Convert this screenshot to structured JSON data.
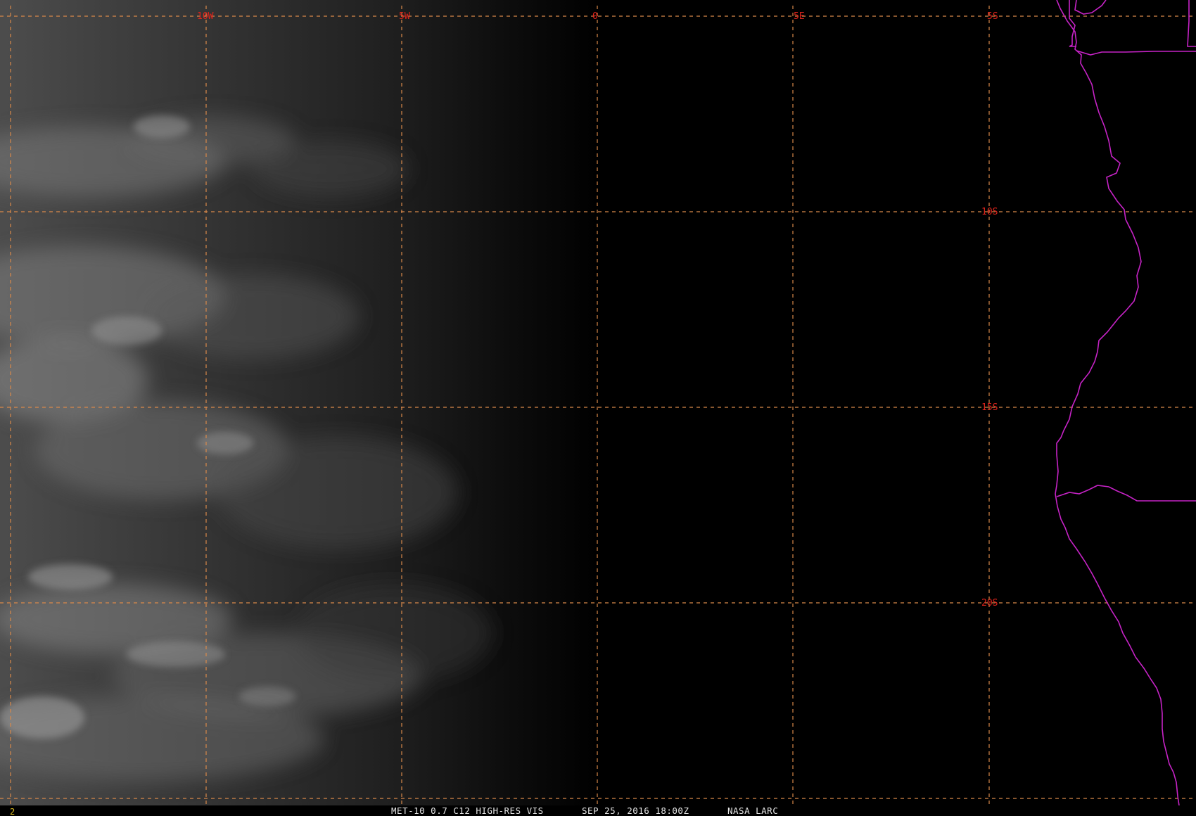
{
  "frame_number": "2",
  "caption": {
    "product": "MET-10 0.7 C12 HIGH-RES VIS",
    "datetime": "SEP 25, 2016 18:00Z",
    "source": "NASA LARC"
  },
  "grid": {
    "longitude_labels": [
      "10W",
      "5W",
      "0",
      "5E"
    ],
    "latitude_labels": [
      "5S",
      "10S",
      "15S",
      "20S"
    ]
  },
  "colors": {
    "background": "#000000",
    "gridline": "#d9894a",
    "grid_label": "#e0241c",
    "coastline_and_borders": "#c623c6",
    "caption_text": "#e6e6e6",
    "frame_number": "#e0c020"
  }
}
